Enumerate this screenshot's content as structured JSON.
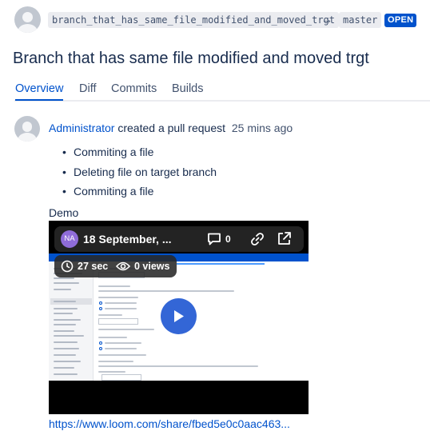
{
  "header": {
    "source_branch": "branch_that_has_same_file_modified_and_moved_trgt",
    "arrow": "→",
    "target_branch": "master",
    "status": "OPEN"
  },
  "pull_request": {
    "title": "Branch that has same file modified and moved trgt"
  },
  "tabs": [
    {
      "label": "Overview",
      "active": true
    },
    {
      "label": "Diff",
      "active": false
    },
    {
      "label": "Commits",
      "active": false
    },
    {
      "label": "Builds",
      "active": false
    }
  ],
  "activity": {
    "author": "Administrator",
    "action": "created a pull request",
    "time": "25 mins ago",
    "commits": [
      "Commiting a file",
      "Deleting file on target branch",
      "Commiting a file"
    ],
    "description_label": "Demo",
    "video": {
      "owner_initials": "NA",
      "title": "18 September, ...",
      "comment_count": "0",
      "duration": "27 sec",
      "views": "0 views"
    },
    "link_text": "https://www.loom.com/share/fbed5e0c0aac463..."
  },
  "colors": {
    "accent": "#0052cc",
    "status_badge": "#0052cc",
    "play_button": "#3366d6",
    "owner_avatar": "#8f6cd9"
  },
  "icons": [
    "user-avatar-icon",
    "arrow-right-icon",
    "comment-icon",
    "link-icon",
    "external-link-icon",
    "clock-icon",
    "eye-icon",
    "play-icon"
  ]
}
